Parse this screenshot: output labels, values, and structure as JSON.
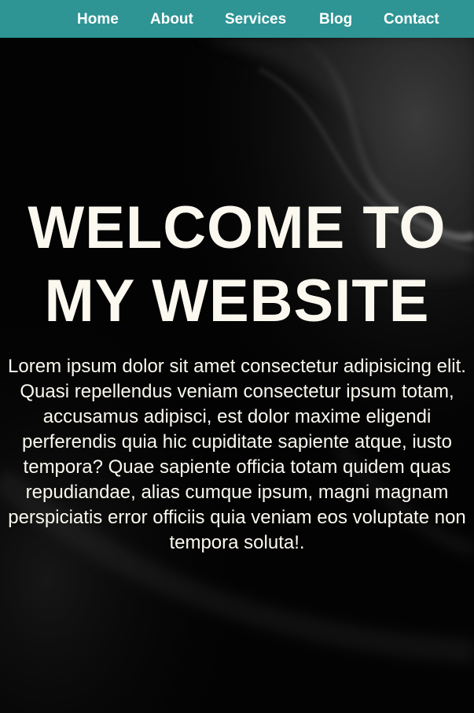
{
  "nav": {
    "items": [
      {
        "label": "Home"
      },
      {
        "label": "About"
      },
      {
        "label": "Services"
      },
      {
        "label": "Blog"
      },
      {
        "label": "Contact"
      }
    ]
  },
  "hero": {
    "title": "WELCOME TO MY WEBSITE",
    "text": "Lorem ipsum dolor sit amet consectetur adipisicing elit. Quasi repellendus veniam consectetur ipsum totam, accusamus adipisci, est dolor maxime eligendi perferendis quia hic cupiditate sapiente atque, iusto tempora? Quae sapiente officia totam quidem quas repudiandae, alias cumque ipsum, magni magnam perspiciatis error officiis quia veniam eos voluptate non tempora soluta!."
  },
  "colors": {
    "navbar": "#2e9494",
    "text": "#fbf8ef",
    "background": "#000000"
  }
}
